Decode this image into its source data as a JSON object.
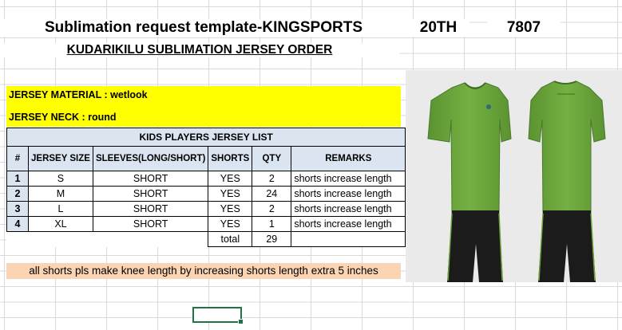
{
  "title": "Sublimation request template-KINGSPORTS",
  "code_a": "20TH",
  "code_b": "7807",
  "subtitle": "KUDARIKILU  SUBLIMATION JERSEY ORDER",
  "material": "JERSEY MATERIAL : wetlook",
  "neck": "JERSEY NECK : round",
  "table": {
    "caption": "KIDS  PLAYERS JERSEY LIST",
    "headers": [
      "#",
      "JERSEY SIZE",
      "SLEEVES(LONG/SHORT)",
      "SHORTS",
      "QTY",
      "REMARKS"
    ],
    "rows": [
      {
        "n": "1",
        "size": "S",
        "sleeves": "SHORT",
        "shorts": "YES",
        "qty": "2",
        "remarks": "shorts increase length"
      },
      {
        "n": "2",
        "size": "M",
        "sleeves": "SHORT",
        "shorts": "YES",
        "qty": "24",
        "remarks": "shorts increase length"
      },
      {
        "n": "3",
        "size": "L",
        "sleeves": "SHORT",
        "shorts": "YES",
        "qty": "2",
        "remarks": "shorts increase length"
      },
      {
        "n": "4",
        "size": "XL",
        "sleeves": "SHORT",
        "shorts": "YES",
        "qty": "1",
        "remarks": "shorts increase length"
      }
    ],
    "total_label": "total",
    "total_value": "29"
  },
  "note": "all shorts pls make knee length by increasing shorts length extra 5 inches",
  "colors": {
    "yellow": "#ffff00",
    "header_blue": "#dbe5f1",
    "note_peach": "#fbd4b4",
    "jersey_green": "#6aa33a",
    "shorts_black": "#1b1b1b",
    "selection": "#217346"
  },
  "mockup": {
    "front_icon": "jersey-front",
    "back_icon": "jersey-back"
  }
}
